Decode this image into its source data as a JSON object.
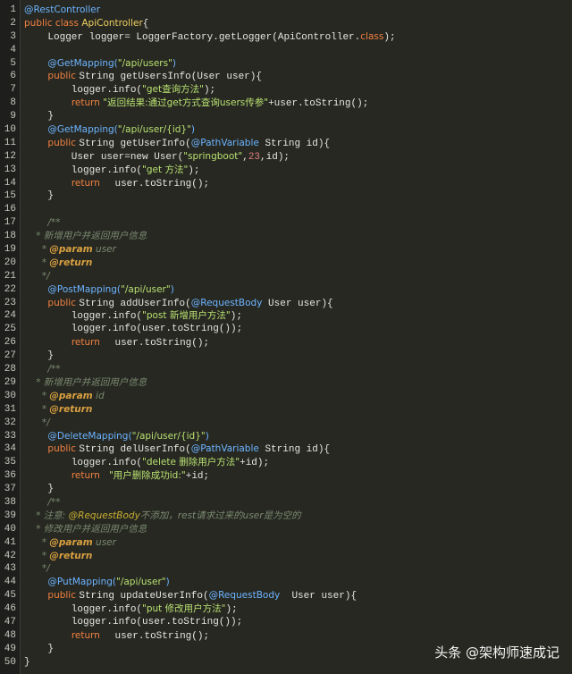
{
  "lines": [
    {
      "n": "1",
      "t": [
        [
          "ann",
          "@RestController"
        ]
      ]
    },
    {
      "n": "2",
      "t": [
        [
          "kw",
          "public class "
        ],
        [
          "cls",
          "ApiController"
        ],
        [
          "",
          "{"
        ]
      ]
    },
    {
      "n": "3",
      "t": [
        [
          "",
          "    Logger logger= LoggerFactory.getLogger(ApiController."
        ],
        [
          "kw",
          "class"
        ],
        [
          "",
          ");"
        ]
      ]
    },
    {
      "n": "4",
      "t": []
    },
    {
      "n": "5",
      "t": [
        [
          "",
          "    "
        ],
        [
          "ann",
          "@GetMapping("
        ],
        [
          "str",
          "\"/api/users\""
        ],
        [
          "ann",
          ")"
        ]
      ]
    },
    {
      "n": "6",
      "t": [
        [
          "",
          "    "
        ],
        [
          "kw",
          "public "
        ],
        [
          "",
          "String getUsersInfo(User user){"
        ]
      ]
    },
    {
      "n": "7",
      "t": [
        [
          "",
          "        logger.info("
        ],
        [
          "str",
          "\"get查询方法\""
        ],
        [
          "",
          ");"
        ]
      ]
    },
    {
      "n": "8",
      "t": [
        [
          "",
          "        "
        ],
        [
          "kw",
          "return "
        ],
        [
          "str",
          "\"返回结果:通过get方式查询users传参\""
        ],
        [
          "",
          "+user.toString();"
        ]
      ]
    },
    {
      "n": "9",
      "t": [
        [
          "",
          "    }"
        ]
      ]
    },
    {
      "n": "10",
      "t": [
        [
          "",
          "    "
        ],
        [
          "ann",
          "@GetMapping("
        ],
        [
          "str",
          "\"/api/user/{id}\""
        ],
        [
          "ann",
          ")"
        ]
      ]
    },
    {
      "n": "11",
      "t": [
        [
          "",
          "    "
        ],
        [
          "kw",
          "public "
        ],
        [
          "",
          "String getUserInfo("
        ],
        [
          "ann",
          "@PathVariable"
        ],
        [
          "",
          " String id){"
        ]
      ]
    },
    {
      "n": "12",
      "t": [
        [
          "",
          "        User user=new User("
        ],
        [
          "str",
          "\"springboot\""
        ],
        [
          "",
          ","
        ],
        [
          "num",
          "23"
        ],
        [
          "",
          ",id);"
        ]
      ]
    },
    {
      "n": "13",
      "t": [
        [
          "",
          "        logger.info("
        ],
        [
          "str",
          "\"get 方法\""
        ],
        [
          "",
          ");"
        ]
      ]
    },
    {
      "n": "14",
      "t": [
        [
          "",
          "        "
        ],
        [
          "kw",
          "return "
        ],
        [
          "",
          "  user.toString();"
        ]
      ]
    },
    {
      "n": "15",
      "t": [
        [
          "",
          "    }"
        ]
      ]
    },
    {
      "n": "16",
      "t": []
    },
    {
      "n": "17",
      "t": [
        [
          "",
          "    "
        ],
        [
          "cm",
          "/**"
        ]
      ]
    },
    {
      "n": "18",
      "t": [
        [
          "",
          "  "
        ],
        [
          "cm",
          "* 新增用户并返回用户信息"
        ]
      ]
    },
    {
      "n": "19",
      "t": [
        [
          "",
          "   "
        ],
        [
          "cm",
          "* "
        ],
        [
          "cmtag",
          "@param"
        ],
        [
          "cm",
          " user"
        ]
      ]
    },
    {
      "n": "20",
      "t": [
        [
          "",
          "   "
        ],
        [
          "cm",
          "* "
        ],
        [
          "cmtag",
          "@return"
        ]
      ]
    },
    {
      "n": "21",
      "t": [
        [
          "",
          "   "
        ],
        [
          "cm",
          "*/"
        ]
      ]
    },
    {
      "n": "22",
      "t": [
        [
          "",
          "    "
        ],
        [
          "ann",
          "@PostMapping("
        ],
        [
          "str",
          "\"/api/user\""
        ],
        [
          "ann",
          ")"
        ]
      ]
    },
    {
      "n": "23",
      "t": [
        [
          "",
          "    "
        ],
        [
          "kw",
          "public "
        ],
        [
          "",
          "String addUserInfo("
        ],
        [
          "ann",
          "@RequestBody"
        ],
        [
          "",
          " User user){"
        ]
      ]
    },
    {
      "n": "24",
      "t": [
        [
          "",
          "        logger.info("
        ],
        [
          "str",
          "\"post 新增用户方法\""
        ],
        [
          "",
          ");"
        ]
      ]
    },
    {
      "n": "25",
      "t": [
        [
          "",
          "        logger.info(user.toString());"
        ]
      ]
    },
    {
      "n": "26",
      "t": [
        [
          "",
          "        "
        ],
        [
          "kw",
          "return "
        ],
        [
          "",
          "  user.toString();"
        ]
      ]
    },
    {
      "n": "27",
      "t": [
        [
          "",
          "    }"
        ]
      ]
    },
    {
      "n": "28",
      "t": [
        [
          "",
          "    "
        ],
        [
          "cm",
          "/**"
        ]
      ]
    },
    {
      "n": "29",
      "t": [
        [
          "",
          "  "
        ],
        [
          "cm",
          "* 新增用户并返回用户信息"
        ]
      ]
    },
    {
      "n": "30",
      "t": [
        [
          "",
          "   "
        ],
        [
          "cm",
          "* "
        ],
        [
          "cmtag",
          "@param"
        ],
        [
          "cm",
          " id"
        ]
      ]
    },
    {
      "n": "31",
      "t": [
        [
          "",
          "   "
        ],
        [
          "cm",
          "* "
        ],
        [
          "cmtag",
          "@return"
        ]
      ]
    },
    {
      "n": "32",
      "t": [
        [
          "",
          "   "
        ],
        [
          "cm",
          "*/"
        ]
      ]
    },
    {
      "n": "33",
      "t": [
        [
          "",
          "    "
        ],
        [
          "ann",
          "@DeleteMapping("
        ],
        [
          "str",
          "\"/api/user/{id}\""
        ],
        [
          "ann",
          ")"
        ]
      ]
    },
    {
      "n": "34",
      "t": [
        [
          "",
          "    "
        ],
        [
          "kw",
          "public "
        ],
        [
          "",
          "String delUserInfo("
        ],
        [
          "ann",
          "@PathVariable"
        ],
        [
          "",
          " String id){"
        ]
      ]
    },
    {
      "n": "35",
      "t": [
        [
          "",
          "        logger.info("
        ],
        [
          "str",
          "\"delete 删除用户方法\""
        ],
        [
          "",
          "+id);"
        ]
      ]
    },
    {
      "n": "36",
      "t": [
        [
          "",
          "        "
        ],
        [
          "kw",
          "return "
        ],
        [
          "str",
          "  \"用户删除成功id:\""
        ],
        [
          "",
          "+id;"
        ]
      ]
    },
    {
      "n": "37",
      "t": [
        [
          "",
          "    }"
        ]
      ]
    },
    {
      "n": "38",
      "t": [
        [
          "",
          "    "
        ],
        [
          "cm",
          "/**"
        ]
      ]
    },
    {
      "n": "39",
      "t": [
        [
          "",
          "  "
        ],
        [
          "cm",
          "* 注意: "
        ],
        [
          "cmtag2",
          "@RequestBody"
        ],
        [
          "cm",
          "不添加，rest请求过来的user是为空的"
        ]
      ]
    },
    {
      "n": "40",
      "t": [
        [
          "",
          "  "
        ],
        [
          "cm",
          "* 修改用户并返回用户信息"
        ]
      ]
    },
    {
      "n": "41",
      "t": [
        [
          "",
          "   "
        ],
        [
          "cm",
          "* "
        ],
        [
          "cmtag",
          "@param"
        ],
        [
          "cm",
          " user"
        ]
      ]
    },
    {
      "n": "42",
      "t": [
        [
          "",
          "   "
        ],
        [
          "cm",
          "* "
        ],
        [
          "cmtag",
          "@return"
        ]
      ]
    },
    {
      "n": "43",
      "t": [
        [
          "",
          "   "
        ],
        [
          "cm",
          "*/"
        ]
      ]
    },
    {
      "n": "44",
      "t": [
        [
          "",
          "    "
        ],
        [
          "ann",
          "@PutMapping("
        ],
        [
          "str",
          "\"/api/user\""
        ],
        [
          "ann",
          ")"
        ]
      ]
    },
    {
      "n": "45",
      "t": [
        [
          "",
          "    "
        ],
        [
          "kw",
          "public "
        ],
        [
          "",
          "String updateUserInfo("
        ],
        [
          "ann",
          "@RequestBody"
        ],
        [
          "",
          "  User user){"
        ]
      ]
    },
    {
      "n": "46",
      "t": [
        [
          "",
          "        logger.info("
        ],
        [
          "str",
          "\"put 修改用户方法\""
        ],
        [
          "",
          ");"
        ]
      ]
    },
    {
      "n": "47",
      "t": [
        [
          "",
          "        logger.info(user.toString());"
        ]
      ]
    },
    {
      "n": "48",
      "t": [
        [
          "",
          "        "
        ],
        [
          "kw",
          "return "
        ],
        [
          "",
          "  user.toString();"
        ]
      ]
    },
    {
      "n": "49",
      "t": [
        [
          "",
          "    }"
        ]
      ]
    },
    {
      "n": "50",
      "t": [
        [
          "",
          "}"
        ]
      ]
    }
  ],
  "watermark": "头条 @架构师速成记"
}
